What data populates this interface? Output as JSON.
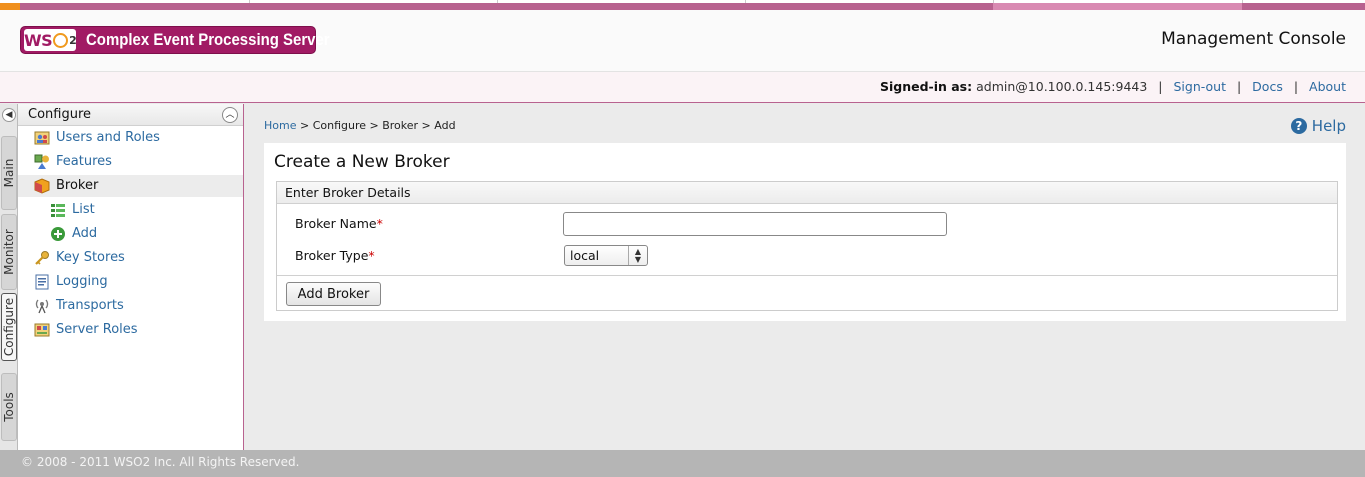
{
  "header": {
    "logo_text": "WSO2",
    "product_name": "Complex Event Processing Server",
    "console_title": "Management Console"
  },
  "user_bar": {
    "signed_in_label": "Signed-in as:",
    "user": "admin@10.100.0.145:9443",
    "sign_out": "Sign-out",
    "docs": "Docs",
    "about": "About"
  },
  "vertical_tabs": [
    {
      "label": "Main"
    },
    {
      "label": "Monitor"
    },
    {
      "label": "Configure",
      "active": true
    },
    {
      "label": "Tools"
    }
  ],
  "sidebar": {
    "title": "Configure",
    "items": [
      {
        "label": "Users and Roles",
        "icon": "users-icon"
      },
      {
        "label": "Features",
        "icon": "features-icon"
      },
      {
        "label": "Broker",
        "icon": "broker-icon",
        "selected": true
      },
      {
        "label": "List",
        "icon": "list-icon"
      },
      {
        "label": "Add",
        "icon": "add-icon"
      },
      {
        "label": "Key Stores",
        "icon": "key-icon"
      },
      {
        "label": "Logging",
        "icon": "logging-icon"
      },
      {
        "label": "Transports",
        "icon": "transports-icon"
      },
      {
        "label": "Server Roles",
        "icon": "server-roles-icon"
      }
    ]
  },
  "breadcrumb": {
    "home": "Home",
    "rest": " > Configure > Broker > Add"
  },
  "help_label": "Help",
  "form": {
    "title": "Create a New Broker",
    "section": "Enter Broker Details",
    "broker_name_label": "Broker Name",
    "broker_name_value": "",
    "broker_type_label": "Broker Type",
    "broker_type_value": "local",
    "required_mark": "*",
    "submit_label": "Add Broker"
  },
  "footer": {
    "copyright": "© 2008 - 2011 WSO2 Inc. All Rights Reserved."
  },
  "colors": {
    "brand": "#a11b64",
    "accent_orange": "#f0901e",
    "link": "#2c6aa0"
  }
}
